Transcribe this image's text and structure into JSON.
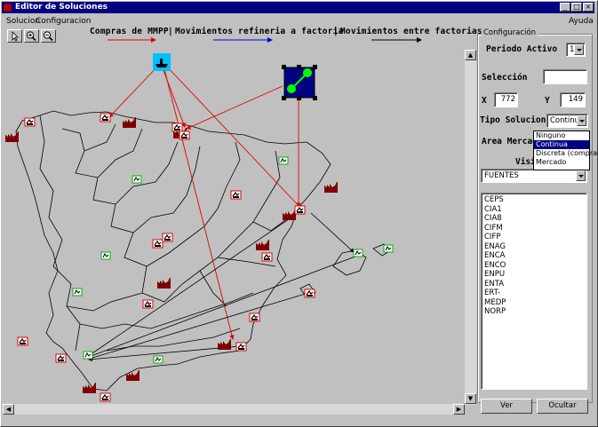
{
  "window": {
    "title": "Editor de Soluciones"
  },
  "menu": {
    "items": [
      "Solucion",
      "Configuracion"
    ],
    "help": "Ayuda"
  },
  "toolbar": {
    "tools": [
      "pointer-tool",
      "zoom-in-tool",
      "zoom-out-tool"
    ]
  },
  "legend": {
    "items": [
      {
        "label": "Compras de MMPP",
        "color": "#e00000"
      },
      {
        "label": "Movimientos refineria a factoria",
        "color": "#0000e0"
      },
      {
        "label": "Movimientos entre factorias",
        "color": "#000000"
      }
    ],
    "separator": "|"
  },
  "config": {
    "group_title": "Configuración",
    "periodo_label": "Periodo Activo",
    "periodo_value": "1",
    "seleccion_label": "Selección",
    "seleccion_value": "",
    "x_label": "X",
    "x_value": "772",
    "y_label": "Y",
    "y_value": "149",
    "tipo_label": "Tipo Solucion",
    "tipo_value": "Continua",
    "tipo_options": [
      "Ninguno",
      "Continua",
      "Discreta (compras)",
      "Mercado"
    ],
    "area_label": "Area Mercad",
    "vis_label": "Visi",
    "fuentes_value": "FUENTES",
    "list_items": [
      "CEPS",
      "CIA1",
      "CIA8",
      "CIFM",
      "CIFP",
      "ENAG",
      "ENCA",
      "ENCO",
      "ENPU",
      "ENTA",
      "ERT-",
      "MEDP",
      "NORP"
    ],
    "ver_button": "Ver",
    "ocultar_button": "Ocultar"
  },
  "colors": {
    "factory": "#800000",
    "refinery_fill": "#000080",
    "refinery_node": "#00ff00",
    "ship_bg": "#00c0ff",
    "market_border": "#00c000",
    "node_border": "#ff0000"
  }
}
